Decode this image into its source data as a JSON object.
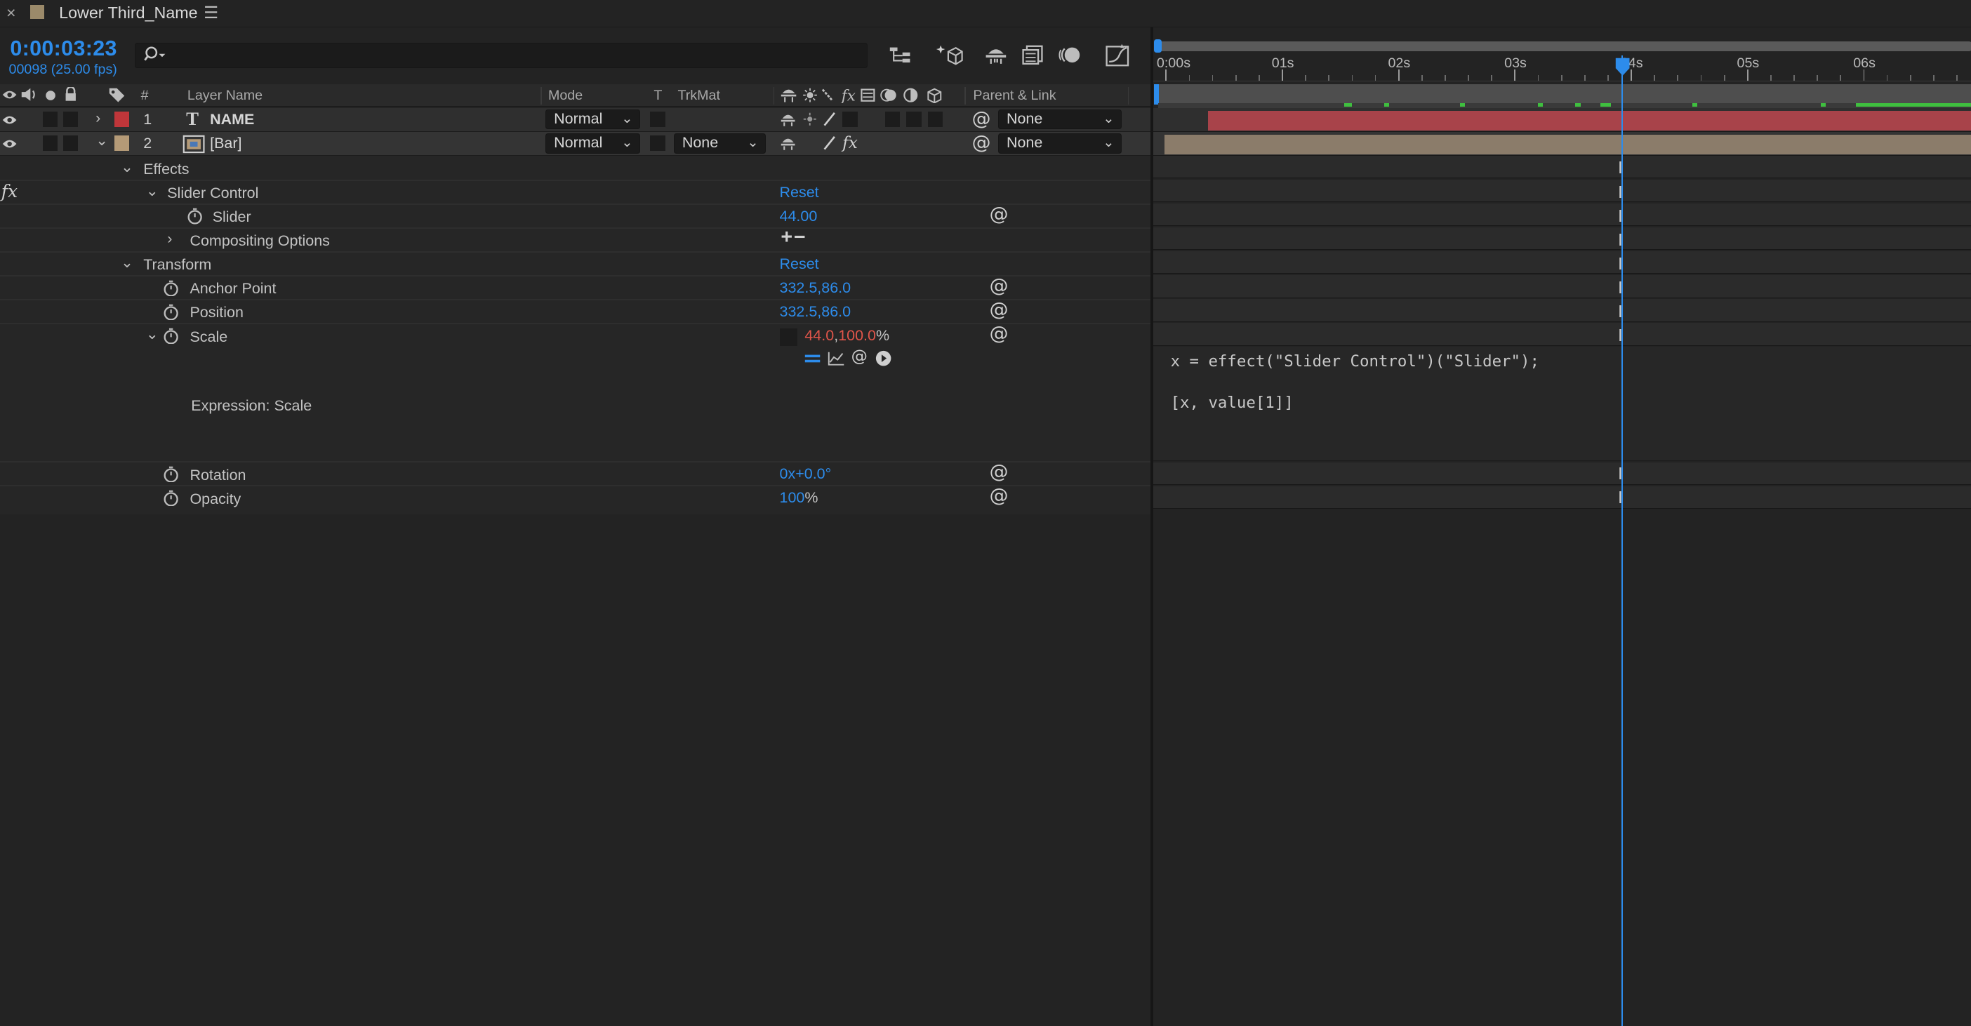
{
  "tab": {
    "title": "Lower Third_Name",
    "label_color": "#9b8a6a"
  },
  "timecode": {
    "time": "0:00:03:23",
    "frames": "00098 (25.00 fps)"
  },
  "search": {
    "placeholder": "",
    "icon": "search-icon"
  },
  "toolbar": {
    "icons": [
      "composition-flowchart-icon",
      "draft-3d-icon",
      "shy-layers-icon",
      "frame-blending-icon",
      "motion-blur-icon",
      "graph-editor-icon"
    ]
  },
  "columns": {
    "number": "#",
    "layer_name": "Layer Name",
    "mode": "Mode",
    "t": "T",
    "trkmat": "TrkMat",
    "parent": "Parent & Link"
  },
  "layers": [
    {
      "num": "1",
      "name": "NAME",
      "type": "text-layer",
      "color": "#c0363a",
      "mode": "Normal",
      "trkmat": "",
      "parent": "None"
    },
    {
      "num": "2",
      "name": "[Bar]",
      "type": "solid-layer",
      "color": "#b49a77",
      "mode": "Normal",
      "trkmat": "None",
      "parent": "None"
    }
  ],
  "props": {
    "effects": "Effects",
    "slider_control": "Slider Control",
    "slider_control_reset": "Reset",
    "slider": "Slider",
    "slider_value": "44.00",
    "compositing": "Compositing Options",
    "compositing_buttons": "+−",
    "transform": "Transform",
    "transform_reset": "Reset",
    "anchor": "Anchor Point",
    "anchor_value": "332.5,86.0",
    "position": "Position",
    "position_value": "332.5,86.0",
    "scale": "Scale",
    "scale_x": "44.0",
    "scale_sep": ",",
    "scale_y": "100.0",
    "scale_unit": "%",
    "expression_label": "Expression: Scale",
    "rotation": "Rotation",
    "rotation_value": "0x+0.0°",
    "opacity": "Opacity",
    "opacity_value": "100",
    "opacity_unit": "%",
    "fx_label": "fx"
  },
  "expression": {
    "line1": "x = effect(\"Slider Control\")(\"Slider\");",
    "line2": "[x, value[1]]"
  },
  "ruler": {
    "labels": [
      "0:00s",
      "01s",
      "02s",
      "03s",
      "04s",
      "05s",
      "06s"
    ]
  },
  "playhead": {
    "time_fraction": 0.567
  },
  "colors": {
    "accent": "#2d8ceb",
    "value_red": "#e0554a",
    "bar_red": "#a8434a",
    "bar_tan": "#8b7c6a",
    "keyframe_green": "#3fbf3f"
  }
}
